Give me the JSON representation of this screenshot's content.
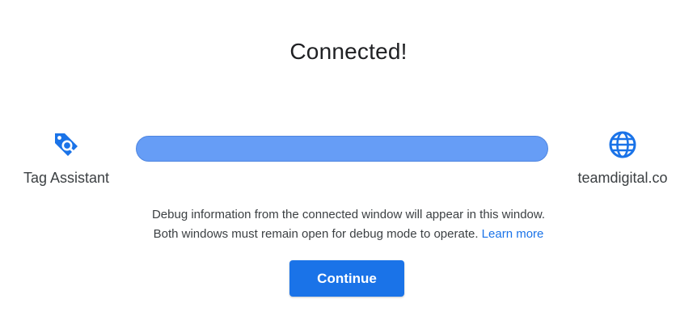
{
  "dialog": {
    "title": "Connected!",
    "source": {
      "label": "Tag Assistant",
      "icon": "tag-search-icon"
    },
    "target": {
      "label": "teamdigital.co",
      "icon": "globe-icon"
    },
    "connection_status_color": "#669df6",
    "info_line1": "Debug information from the connected window will appear in this window.",
    "info_line2": "Both windows must remain open for debug mode to operate.",
    "learn_more": "Learn more",
    "continue_label": "Continue"
  },
  "colors": {
    "accent": "#1a73e8",
    "text": "#3c4043"
  }
}
